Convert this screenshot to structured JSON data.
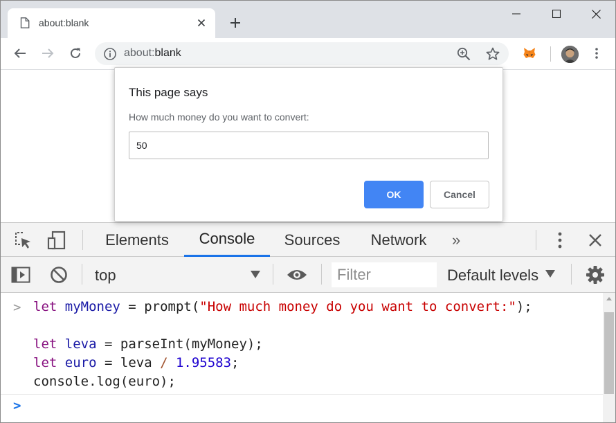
{
  "browser": {
    "tab": {
      "title": "about:blank",
      "favicon": "page-icon"
    },
    "omnibox": {
      "scheme": "about:",
      "rest": "blank"
    },
    "colors": {
      "tabstrip": "#dee1e6",
      "omnibox": "#f1f3f4"
    }
  },
  "dialog": {
    "title": "This page says",
    "message": "How much money do you want to convert:",
    "input_value": "50",
    "ok_label": "OK",
    "cancel_label": "Cancel",
    "colors": {
      "ok": "#4285f4"
    }
  },
  "devtools": {
    "tabs": [
      "Elements",
      "Console",
      "Sources",
      "Network"
    ],
    "active_tab": "Console",
    "more_tabs": "»",
    "context": "top",
    "filter_placeholder": "Filter",
    "levels_label": "Default levels",
    "colors": {
      "active_tab_underline": "#1a73e8",
      "keyword": "#881280",
      "string": "#c80000",
      "number": "#1c00cf"
    }
  },
  "console": {
    "code": {
      "line1": {
        "kw": "let",
        "name": "myMoney",
        "eq": " = ",
        "fn": "prompt(",
        "str": "\"How much money do you want to convert:\"",
        "end": ");"
      },
      "line3": {
        "kw": "let",
        "name": "leva",
        "eq": " = ",
        "rest": "parseInt(myMoney);"
      },
      "line4": {
        "kw": "let",
        "name": "euro",
        "eq": " = ",
        "ref": "leva",
        "op": " / ",
        "num": "1.95583",
        "end": ";"
      },
      "line5": {
        "text": "console.log(euro);"
      }
    },
    "prompt_symbol": ">"
  }
}
